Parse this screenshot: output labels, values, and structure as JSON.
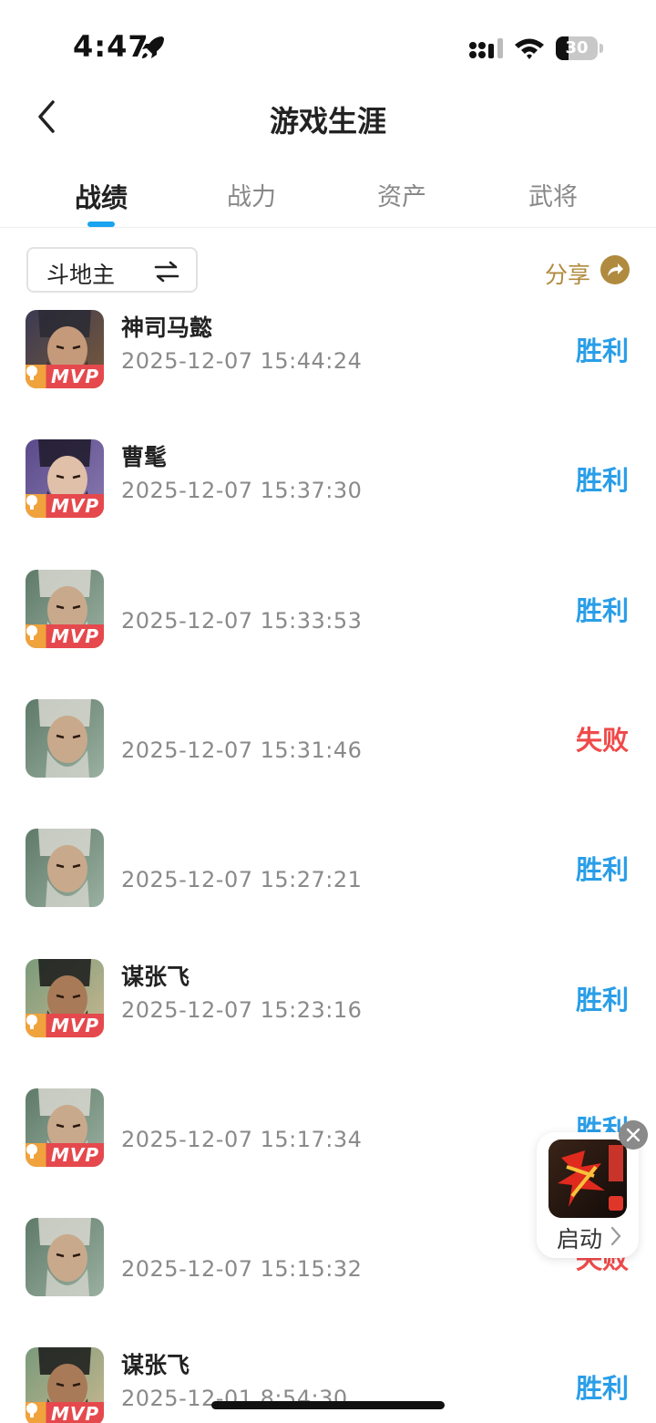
{
  "status_bar": {
    "time": "4:47",
    "battery_level": "30",
    "battery_fraction": 0.3
  },
  "nav": {
    "title": "游戏生涯"
  },
  "tabs": [
    {
      "label": "战绩",
      "active": true
    },
    {
      "label": "战力",
      "active": false
    },
    {
      "label": "资产",
      "active": false
    },
    {
      "label": "武将",
      "active": false
    }
  ],
  "filter": {
    "mode_label": "斗地主"
  },
  "share": {
    "label": "分享"
  },
  "matches": [
    {
      "hero": "神司马懿",
      "time": "2025-12-07 15:44:24",
      "result": "胜利",
      "win": true,
      "mvp": true,
      "avatar": "dark"
    },
    {
      "hero": "曹髦",
      "time": "2025-12-07 15:37:30",
      "result": "胜利",
      "win": true,
      "mvp": true,
      "avatar": "purple"
    },
    {
      "hero": "",
      "time": "2025-12-07 15:33:53",
      "result": "胜利",
      "win": true,
      "mvp": true,
      "avatar": "elder"
    },
    {
      "hero": "",
      "time": "2025-12-07 15:31:46",
      "result": "失败",
      "win": false,
      "mvp": false,
      "avatar": "elder"
    },
    {
      "hero": "",
      "time": "2025-12-07 15:27:21",
      "result": "胜利",
      "win": true,
      "mvp": false,
      "avatar": "elder"
    },
    {
      "hero": "谋张飞",
      "time": "2025-12-07 15:23:16",
      "result": "胜利",
      "win": true,
      "mvp": true,
      "avatar": "zhangfei"
    },
    {
      "hero": "",
      "time": "2025-12-07 15:17:34",
      "result": "胜利",
      "win": true,
      "mvp": true,
      "avatar": "elder"
    },
    {
      "hero": "",
      "time": "2025-12-07 15:15:32",
      "result": "失败",
      "win": false,
      "mvp": false,
      "avatar": "elder"
    },
    {
      "hero": "谋张飞",
      "time": "2025-12-01 8:54:30",
      "result": "胜利",
      "win": true,
      "mvp": true,
      "avatar": "zhangfei"
    }
  ],
  "mvp_badge": "MVP",
  "widget": {
    "label": "启动",
    "icon": "sanguosha-app-icon"
  },
  "colors": {
    "accent": "#1aa3f0",
    "win": "#2a9ee8",
    "lose": "#ef4a4a",
    "share": "#b08a3e"
  }
}
